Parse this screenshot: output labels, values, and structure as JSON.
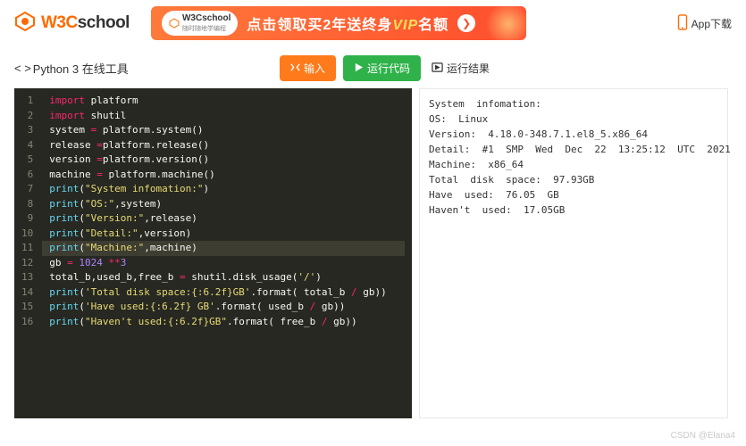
{
  "header": {
    "logo_w3c": "W3C",
    "logo_school": "school",
    "banner_pill_top": "W3Cschool",
    "banner_pill_sub": "随时随地学编程",
    "banner_text_pre": "点击领取买2年送终身",
    "banner_text_vip": "VIP",
    "banner_text_post": "名额",
    "app_download": "App下载"
  },
  "toolbar": {
    "title_prefix": "< >",
    "title": "Python 3 在线工具",
    "input_label": "输入",
    "run_label": "运行代码",
    "result_label": "运行结果"
  },
  "code": {
    "lines": [
      {
        "n": 1,
        "tokens": [
          [
            "kw",
            "import"
          ],
          [
            "",
            " platform"
          ]
        ]
      },
      {
        "n": 2,
        "tokens": [
          [
            "kw",
            "import"
          ],
          [
            "",
            " shutil"
          ]
        ]
      },
      {
        "n": 3,
        "tokens": [
          [
            "",
            "system "
          ],
          [
            "op",
            "="
          ],
          [
            "",
            " platform.system()"
          ]
        ]
      },
      {
        "n": 4,
        "tokens": [
          [
            "",
            "release "
          ],
          [
            "op",
            "="
          ],
          [
            "",
            "platform.release()"
          ]
        ]
      },
      {
        "n": 5,
        "tokens": [
          [
            "",
            "version "
          ],
          [
            "op",
            "="
          ],
          [
            "",
            "platform.version()"
          ]
        ]
      },
      {
        "n": 6,
        "tokens": [
          [
            "",
            "machine "
          ],
          [
            "op",
            "="
          ],
          [
            "",
            " platform.machine()"
          ]
        ]
      },
      {
        "n": 7,
        "tokens": [
          [
            "fn",
            "print"
          ],
          [
            "",
            "("
          ],
          [
            "str",
            "\"System infomation:\""
          ],
          [
            "",
            ")"
          ]
        ]
      },
      {
        "n": 8,
        "tokens": [
          [
            "fn",
            "print"
          ],
          [
            "",
            "("
          ],
          [
            "str",
            "\"OS:\""
          ],
          [
            "",
            ",system)"
          ]
        ]
      },
      {
        "n": 9,
        "tokens": [
          [
            "fn",
            "print"
          ],
          [
            "",
            "("
          ],
          [
            "str",
            "\"Version:\""
          ],
          [
            "",
            ",release)"
          ]
        ]
      },
      {
        "n": 10,
        "tokens": [
          [
            "fn",
            "print"
          ],
          [
            "",
            "("
          ],
          [
            "str",
            "\"Detail:\""
          ],
          [
            "",
            ",version)"
          ]
        ]
      },
      {
        "n": 11,
        "hl": true,
        "tokens": [
          [
            "fn",
            "print"
          ],
          [
            "",
            "("
          ],
          [
            "str",
            "\"Machine:\""
          ],
          [
            "",
            ",machine)"
          ]
        ]
      },
      {
        "n": 12,
        "tokens": [
          [
            "",
            "gb "
          ],
          [
            "op",
            "="
          ],
          [
            "",
            " "
          ],
          [
            "num",
            "1024"
          ],
          [
            "",
            " "
          ],
          [
            "op",
            "**"
          ],
          [
            "num",
            "3"
          ]
        ]
      },
      {
        "n": 13,
        "tokens": [
          [
            "",
            "total_b,used_b,free_b "
          ],
          [
            "op",
            "="
          ],
          [
            "",
            " shutil.disk_usage("
          ],
          [
            "str",
            "'/'"
          ],
          [
            "",
            ")"
          ]
        ]
      },
      {
        "n": 14,
        "tokens": [
          [
            "fn",
            "print"
          ],
          [
            "",
            "("
          ],
          [
            "str",
            "'Total disk space:{:6.2f}GB'"
          ],
          [
            "",
            ".format( total_b "
          ],
          [
            "op",
            "/"
          ],
          [
            "",
            " gb))"
          ]
        ]
      },
      {
        "n": 15,
        "tokens": [
          [
            "fn",
            "print"
          ],
          [
            "",
            "("
          ],
          [
            "str",
            "'Have used:{:6.2f} GB'"
          ],
          [
            "",
            ".format( used_b "
          ],
          [
            "op",
            "/"
          ],
          [
            "",
            " gb))"
          ]
        ]
      },
      {
        "n": 16,
        "tokens": [
          [
            "fn",
            "print"
          ],
          [
            "",
            "("
          ],
          [
            "str",
            "\"Haven't used:{:6.2f}GB\""
          ],
          [
            "",
            ".format( free_b "
          ],
          [
            "op",
            "/"
          ],
          [
            "",
            " gb))"
          ]
        ]
      }
    ]
  },
  "output": {
    "lines": [
      "System  infomation:",
      "OS:  Linux",
      "Version:  4.18.0-348.7.1.el8_5.x86_64",
      "Detail:  #1  SMP  Wed  Dec  22  13:25:12  UTC  2021",
      "Machine:  x86_64",
      "Total  disk  space:  97.93GB",
      "Have  used:  76.05  GB",
      "Haven't  used:  17.05GB"
    ]
  },
  "watermark": "CSDN @Elana4"
}
